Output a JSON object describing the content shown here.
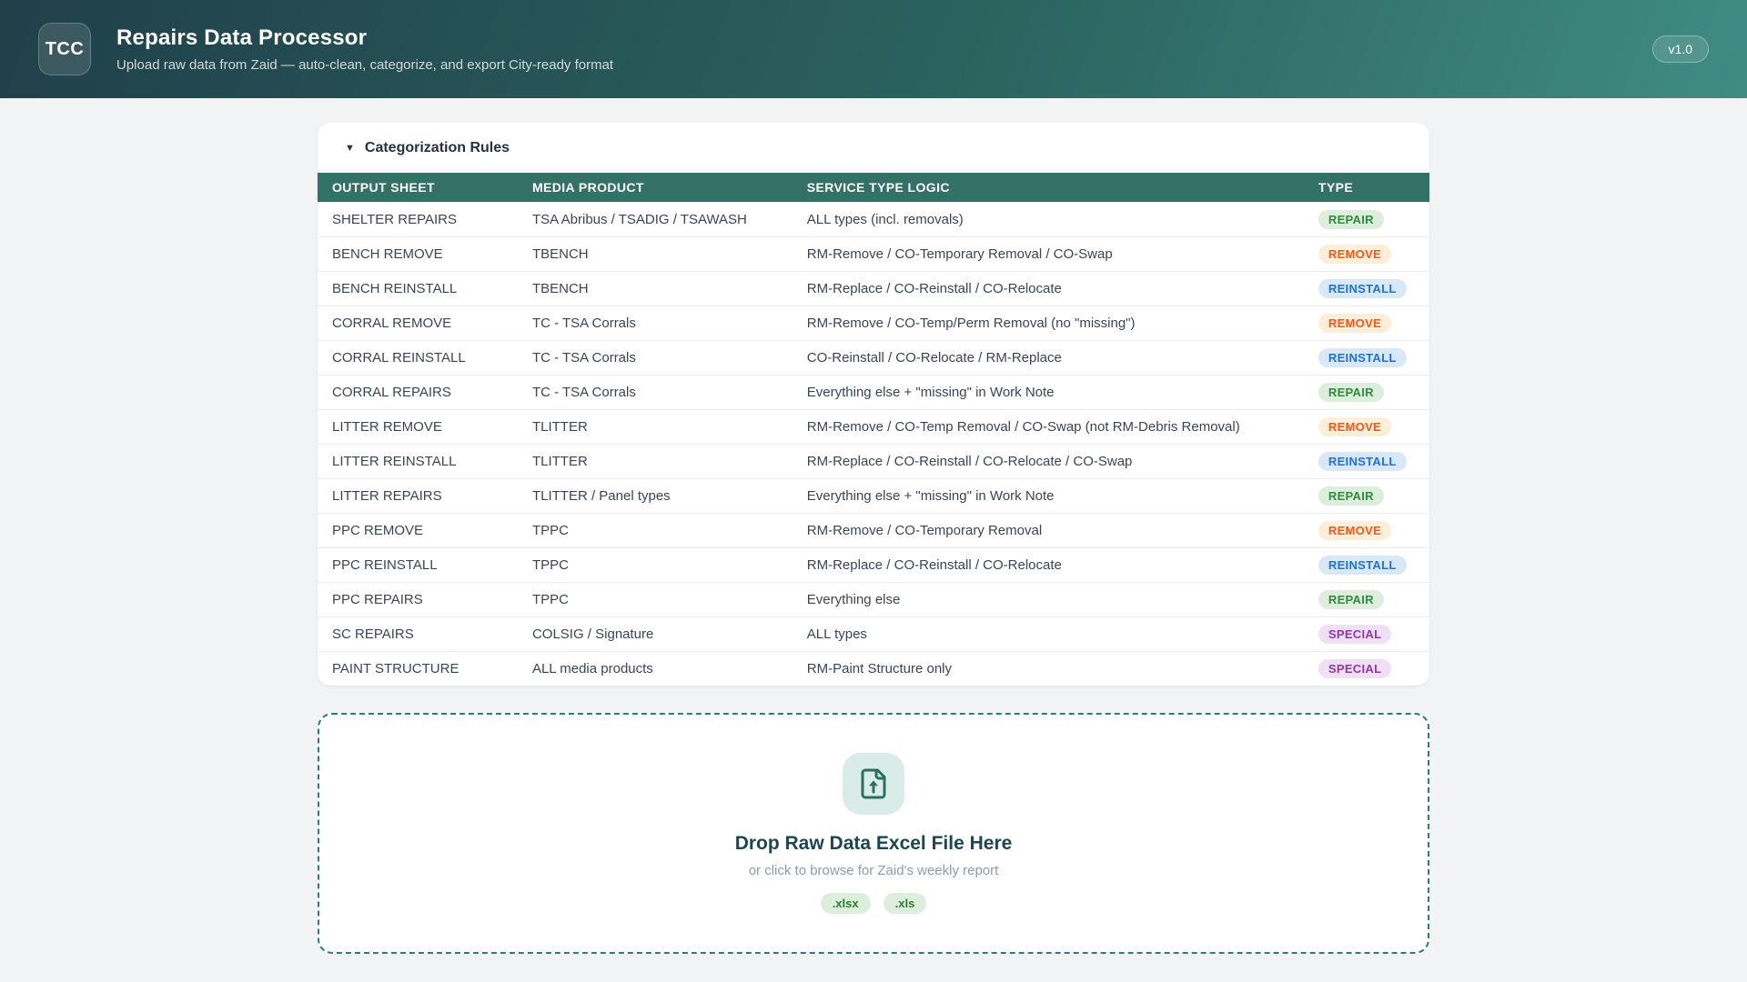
{
  "app": {
    "logo": "TCC",
    "title": "Repairs Data Processor",
    "subtitle": "Upload raw data from Zaid — auto-clean, categorize, and export City-ready format",
    "version": "v1.0"
  },
  "rules": {
    "title": "Categorization Rules",
    "collapse_icon": "▼",
    "columns": [
      "OUTPUT SHEET",
      "MEDIA PRODUCT",
      "SERVICE TYPE LOGIC",
      "TYPE"
    ],
    "rows": [
      {
        "sheet": "SHELTER REPAIRS",
        "media": "TSA Abribus / TSADIG / TSAWASH",
        "logic": "ALL types (incl. removals)",
        "type": "REPAIR"
      },
      {
        "sheet": "BENCH REMOVE",
        "media": "TBENCH",
        "logic": "RM-Remove / CO-Temporary Removal / CO-Swap",
        "type": "REMOVE"
      },
      {
        "sheet": "BENCH REINSTALL",
        "media": "TBENCH",
        "logic": "RM-Replace / CO-Reinstall / CO-Relocate",
        "type": "REINSTALL"
      },
      {
        "sheet": "CORRAL REMOVE",
        "media": "TC - TSA Corrals",
        "logic": "RM-Remove / CO-Temp/Perm Removal (no \"missing\")",
        "type": "REMOVE"
      },
      {
        "sheet": "CORRAL REINSTALL",
        "media": "TC - TSA Corrals",
        "logic": "CO-Reinstall / CO-Relocate / RM-Replace",
        "type": "REINSTALL"
      },
      {
        "sheet": "CORRAL REPAIRS",
        "media": "TC - TSA Corrals",
        "logic": "Everything else + \"missing\" in Work Note",
        "type": "REPAIR"
      },
      {
        "sheet": "LITTER REMOVE",
        "media": "TLITTER",
        "logic": "RM-Remove / CO-Temp Removal / CO-Swap (not RM-Debris Removal)",
        "type": "REMOVE"
      },
      {
        "sheet": "LITTER REINSTALL",
        "media": "TLITTER",
        "logic": "RM-Replace / CO-Reinstall / CO-Relocate / CO-Swap",
        "type": "REINSTALL"
      },
      {
        "sheet": "LITTER REPAIRS",
        "media": "TLITTER / Panel types",
        "logic": "Everything else + \"missing\" in Work Note",
        "type": "REPAIR"
      },
      {
        "sheet": "PPC REMOVE",
        "media": "TPPC",
        "logic": "RM-Remove / CO-Temporary Removal",
        "type": "REMOVE"
      },
      {
        "sheet": "PPC REINSTALL",
        "media": "TPPC",
        "logic": "RM-Replace / CO-Reinstall / CO-Relocate",
        "type": "REINSTALL"
      },
      {
        "sheet": "PPC REPAIRS",
        "media": "TPPC",
        "logic": "Everything else",
        "type": "REPAIR"
      },
      {
        "sheet": "SC REPAIRS",
        "media": "COLSIG / Signature",
        "logic": "ALL types",
        "type": "SPECIAL"
      },
      {
        "sheet": "PAINT STRUCTURE",
        "media": "ALL media products",
        "logic": "RM-Paint Structure only",
        "type": "SPECIAL"
      }
    ],
    "badge_colors": {
      "REPAIR": {
        "bg": "#ddeedd",
        "text": "#2e8b3f"
      },
      "REMOVE": {
        "bg": "#fdeeda",
        "text": "#f2571a"
      },
      "REINSTALL": {
        "bg": "#d8e8f8",
        "text": "#1d72d6"
      },
      "SPECIAL": {
        "bg": "#f0dff5",
        "text": "#8f37ae"
      }
    }
  },
  "dropzone": {
    "title": "Drop Raw Data Excel File Here",
    "subtitle": "or click to browse for Zaid's weekly report",
    "extensions": [
      ".xlsx",
      ".xls"
    ]
  }
}
